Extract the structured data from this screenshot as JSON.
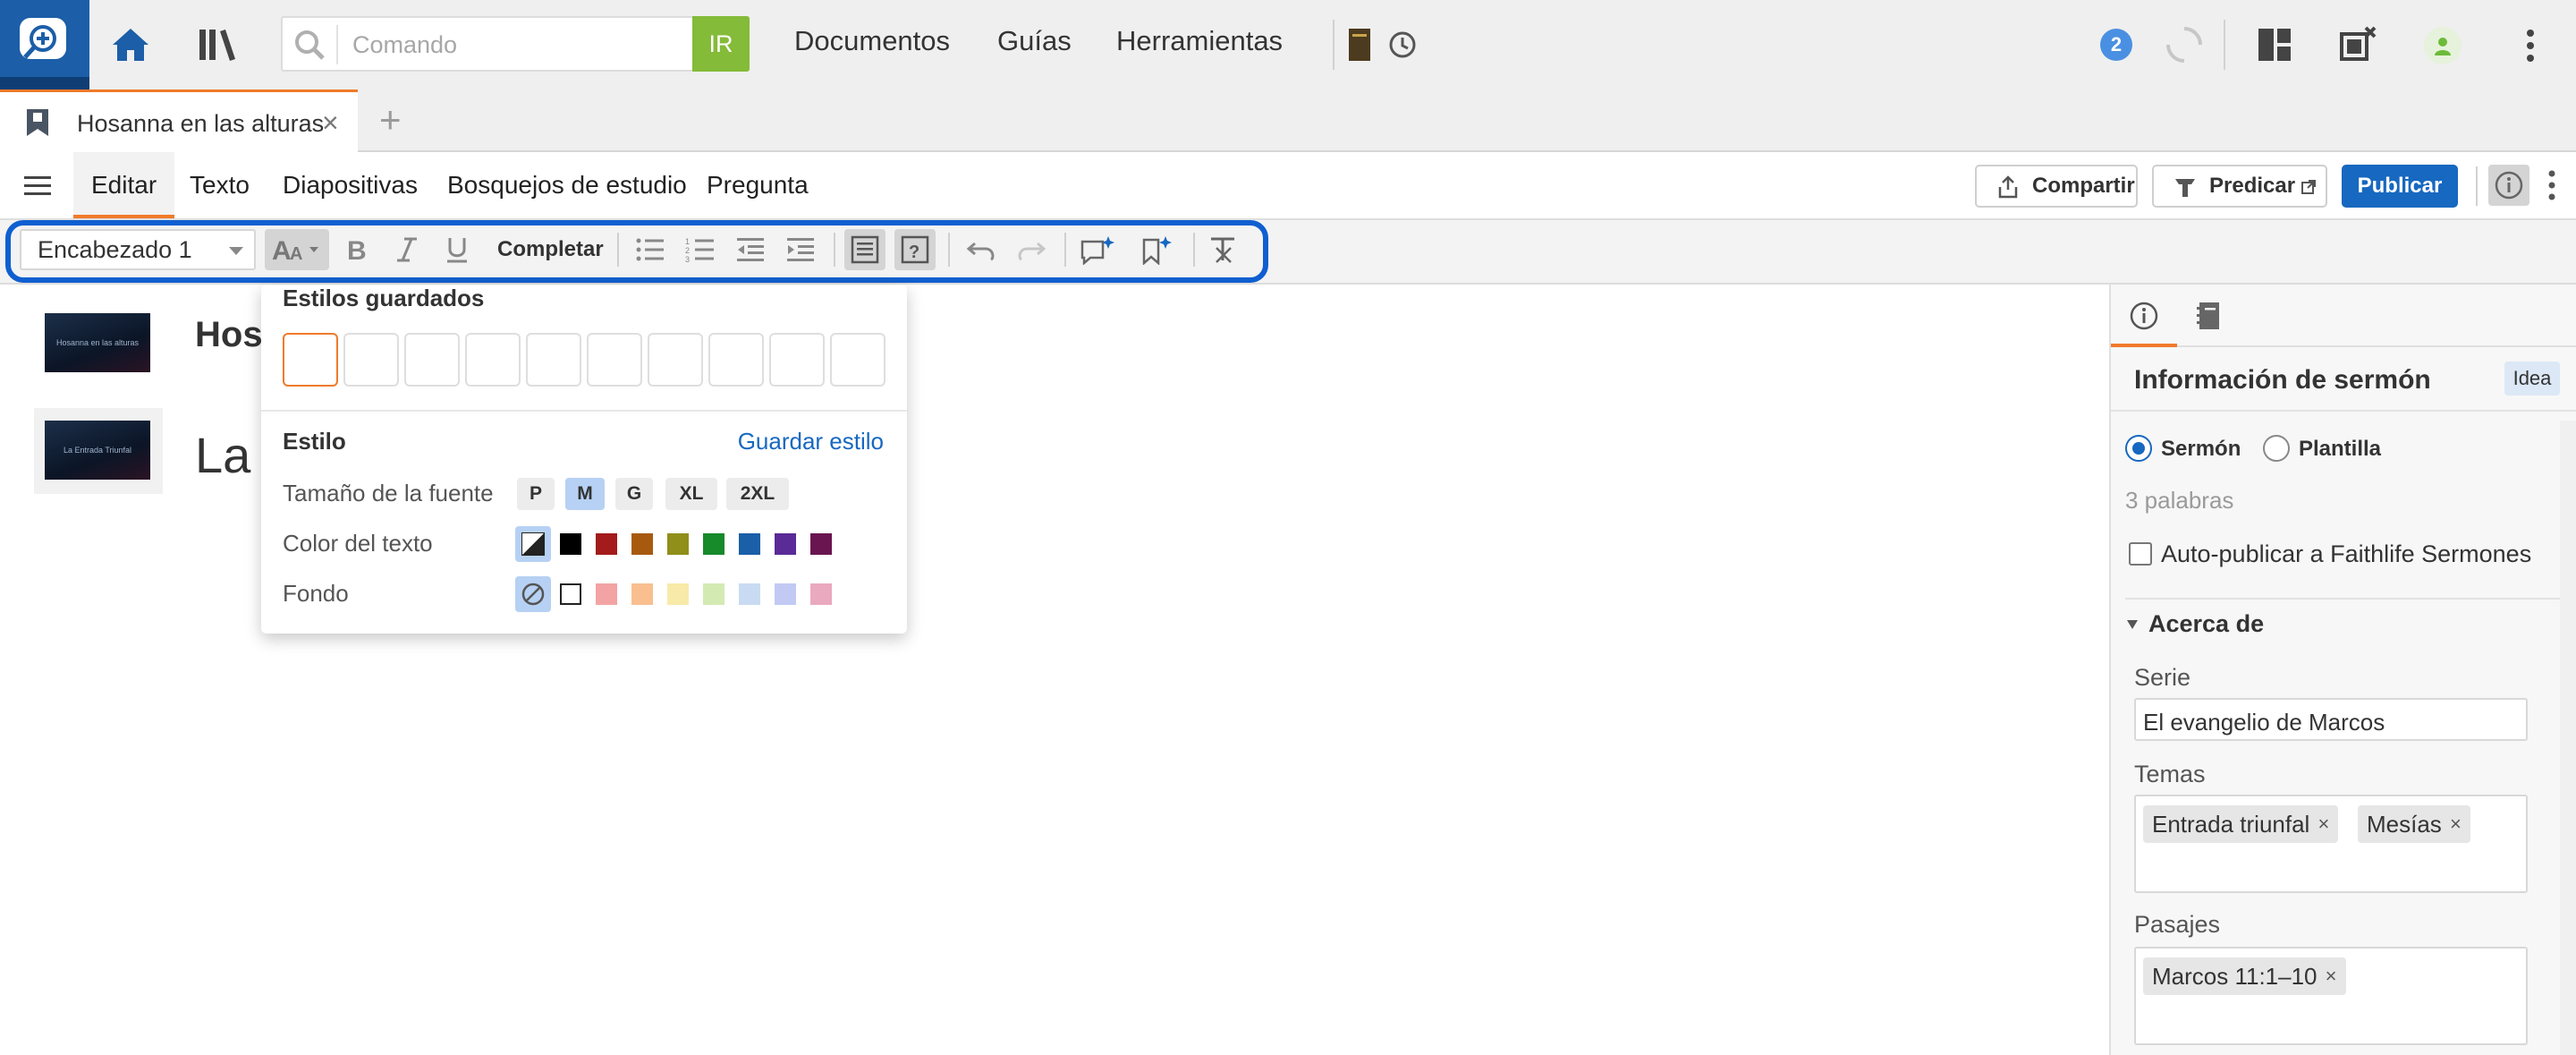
{
  "topbar": {
    "search_placeholder": "Comando",
    "go_label": "IR",
    "nav": [
      "Documentos",
      "Guías",
      "Herramientas"
    ],
    "notification_count": "2"
  },
  "tabs": {
    "document_title": "Hosanna en las alturas"
  },
  "menu": {
    "items": [
      "Editar",
      "Texto",
      "Diapositivas",
      "Bosquejos de estudio",
      "Pregunta"
    ],
    "share_label": "Compartir",
    "preach_label": "Predicar",
    "publish_label": "Publicar"
  },
  "toolbar": {
    "style_value": "Encabezado 1",
    "complete_label": "Completar"
  },
  "editor": {
    "thumb1_text": "Hosanna en las alturas",
    "thumb2_text": "La Entrada Triunfal",
    "heading1": "Hos",
    "heading2": "La E"
  },
  "styles_popup": {
    "saved_styles_title": "Estilos guardados",
    "style_title": "Estilo",
    "save_style_link": "Guardar estilo",
    "font_size_label": "Tamaño de la fuente",
    "font_sizes": [
      "P",
      "M",
      "G",
      "XL",
      "2XL"
    ],
    "selected_size": "M",
    "text_color_label": "Color del texto",
    "text_colors": [
      "#000000",
      "#a31b1b",
      "#a75a0e",
      "#8f8f1a",
      "#178a2a",
      "#1b5fa8",
      "#5a2a96",
      "#6a1550"
    ],
    "background_label": "Fondo",
    "background_colors": [
      "#ffffff",
      "#f3a3a3",
      "#f9bf8f",
      "#f8eaa8",
      "#d3eab3",
      "#c8dbf2",
      "#c2caf4",
      "#eaa9bf"
    ]
  },
  "sidebar": {
    "title": "Información de sermón",
    "badge": "Idea",
    "radio_sermon": "Sermón",
    "radio_template": "Plantilla",
    "word_count": "3 palabras",
    "autopublish_label": "Auto-publicar a Faithlife Sermones",
    "about_section": "Acerca de",
    "series_label": "Serie",
    "series_value": "El evangelio de Marcos",
    "topics_label": "Temas",
    "topics": [
      "Entrada triunfal",
      "Mesías"
    ],
    "passages_label": "Pasajes",
    "passages": [
      "Marcos 11:1–10"
    ]
  },
  "colors": {
    "accent": "#f07a2a",
    "primary": "#1768c0",
    "highlight_frame": "#0f5fd0",
    "search_go": "#84bb38"
  }
}
